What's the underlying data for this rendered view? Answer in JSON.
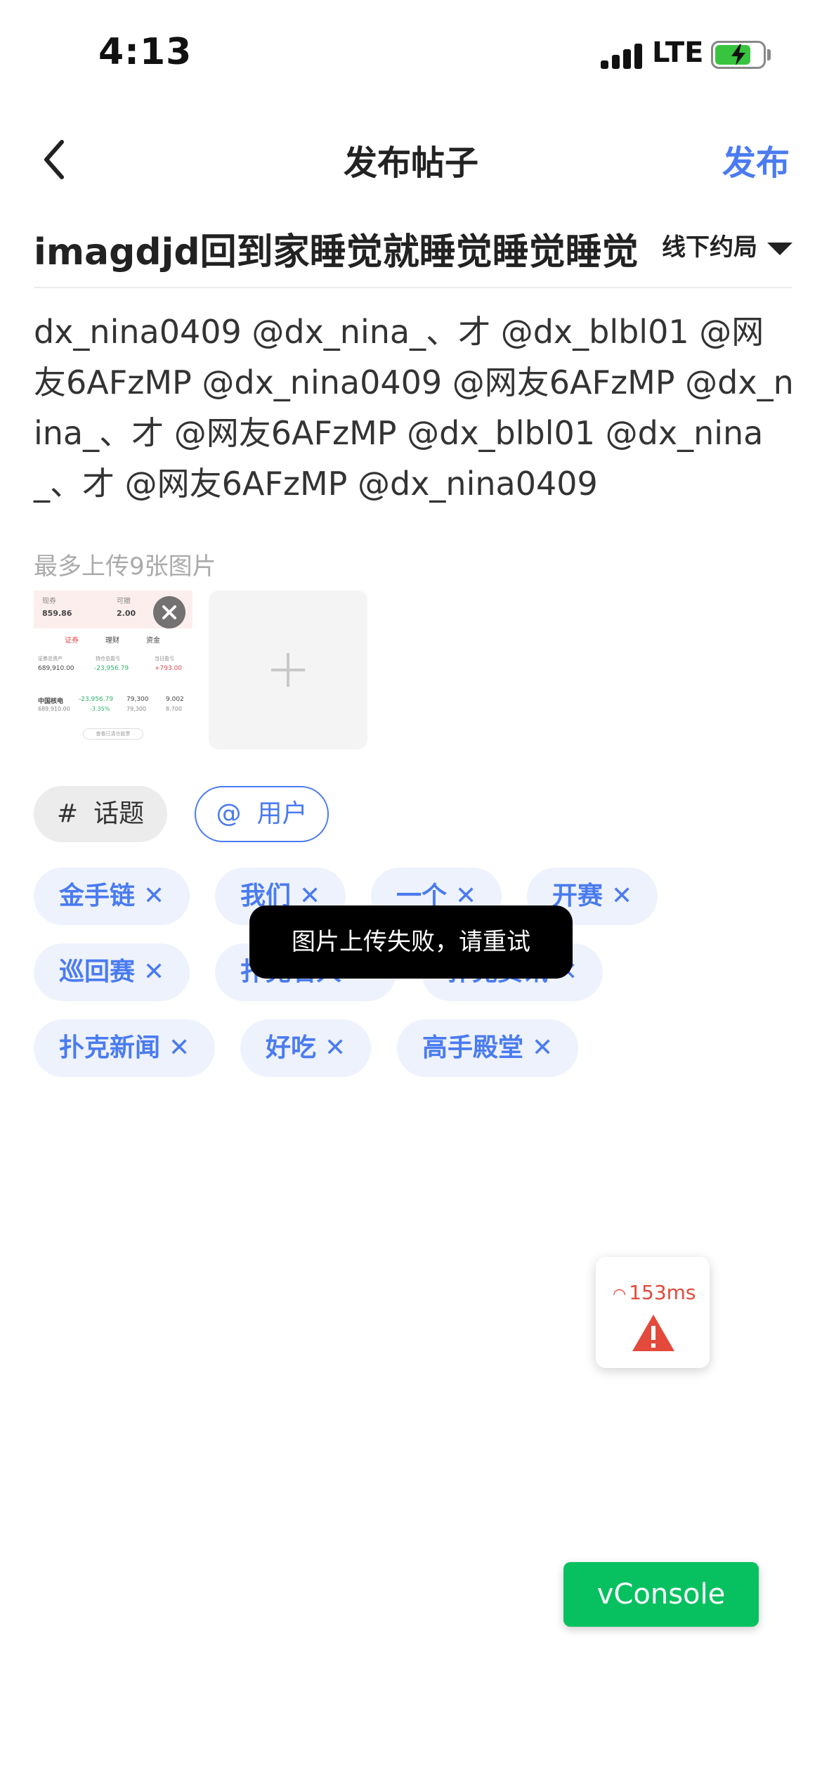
{
  "status_bar": {
    "time": "4:13",
    "network": "LTE"
  },
  "nav": {
    "title": "发布帖子",
    "publish_label": "发布"
  },
  "post": {
    "title": "imagdjd回到家睡觉就睡觉睡觉睡觉",
    "category": "线下约局",
    "body": "dx_nina0409 @dx_nina_、才 @dx_blbl01 @网友6AFzMP @dx_nina0409 @网友6AFzMP @dx_nina_、才 @网友6AFzMP @dx_blbl01 @dx_nina_、才 @网友6AFzMP @dx_nina0409"
  },
  "upload": {
    "hint": "最多上传9张图片",
    "thumbnail": {
      "top_left_label": "现券",
      "top_left_value": "859.86",
      "top_right_label": "可撤",
      "top_right_value": "2.00",
      "tabs": [
        "证券",
        "理财",
        "资金"
      ],
      "col1_label": "证券总资产",
      "col1_value": "689,910.00",
      "col2_label": "持仓总盈亏",
      "col2_value": "-23,956.79",
      "col3_label": "当日盈亏",
      "col3_value": "+793.00",
      "row_name": "中国核电",
      "row_v1": "-23,956.79",
      "row_v2": "79,300",
      "row_v3": "9.002",
      "row_sub1": "689,910.00",
      "row_sub2": "-3.35%",
      "row_sub3": "79,300",
      "row_sub4": "8.700",
      "button": "查看已清仓股票"
    }
  },
  "buttons": {
    "topic": {
      "symbol": "#",
      "label": "话题"
    },
    "user": {
      "symbol": "@",
      "label": "用户"
    }
  },
  "tags": [
    "金手链",
    "我们",
    "一个",
    "开赛",
    "巡回赛",
    "扑克名人",
    "扑克资讯",
    "扑克新闻",
    "好吃",
    "高手殿堂"
  ],
  "toast": "图片上传失败，请重试",
  "network_widget": {
    "latency": "153ms"
  },
  "vconsole": {
    "label": "vConsole"
  },
  "colors": {
    "accent": "#4a7bf0",
    "tag_bg": "#eef2fd",
    "toast_bg": "#000000",
    "vconsole": "#07c160",
    "warning": "#e34a3b"
  }
}
